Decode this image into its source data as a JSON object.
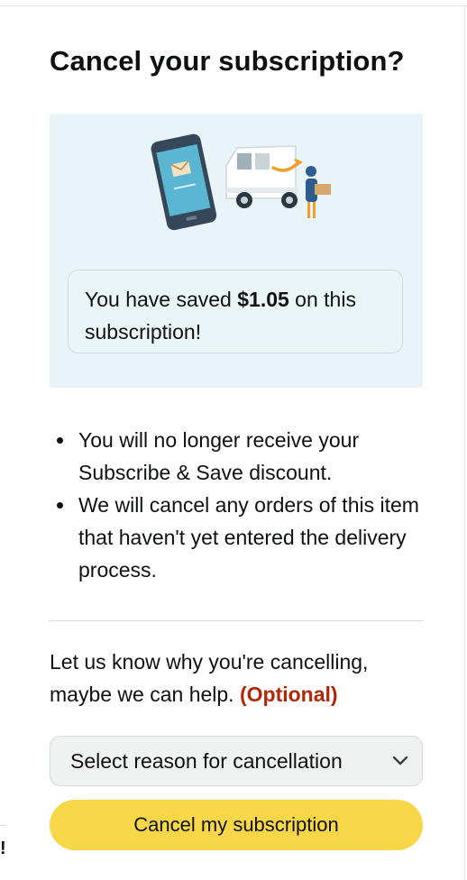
{
  "dialog": {
    "title": "Cancel your subscription?"
  },
  "hero": {
    "illustration_icon": "phone-and-delivery-van-illustration",
    "background_color": "#e8f4f8",
    "savings": {
      "prefix": "You have saved ",
      "amount": "$1.05",
      "suffix": " on this subscription!"
    }
  },
  "info": {
    "items": [
      "You will no longer receive your Subscribe & Save discount.",
      "We will cancel any orders of this item that haven't yet entered the delivery process."
    ]
  },
  "feedback": {
    "prompt": "Let us know why you're cancelling, maybe we can help.",
    "optional_label": "(Optional)",
    "optional_color": "#b12704",
    "select": {
      "selected_value": "Select reason for cancellation",
      "icon": "chevron-down-icon"
    }
  },
  "actions": {
    "cancel_label": "Cancel my subscription",
    "cancel_color": "#f7d748"
  },
  "background_page": {
    "partial_text": "!"
  }
}
